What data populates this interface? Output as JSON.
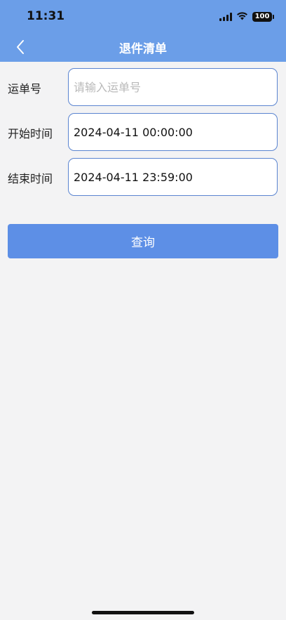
{
  "status_bar": {
    "time": "11:31",
    "battery": "100",
    "icons": [
      "signal-icon",
      "wifi-icon",
      "battery-icon"
    ]
  },
  "nav": {
    "title": "退件清单",
    "back_icon": "chevron-left-icon"
  },
  "form": {
    "waybill": {
      "label": "运单号",
      "value": "",
      "placeholder": "请输入运单号"
    },
    "start_time": {
      "label": "开始时间",
      "value": "2024-04-11 00:00:00"
    },
    "end_time": {
      "label": "结束时间",
      "value": "2024-04-11 23:59:00"
    }
  },
  "query_button": {
    "label": "查询"
  },
  "colors": {
    "header": "#6b9ee8",
    "button": "#5d8fe6",
    "input_border": "#5a84d0",
    "background": "#f3f3f4"
  }
}
